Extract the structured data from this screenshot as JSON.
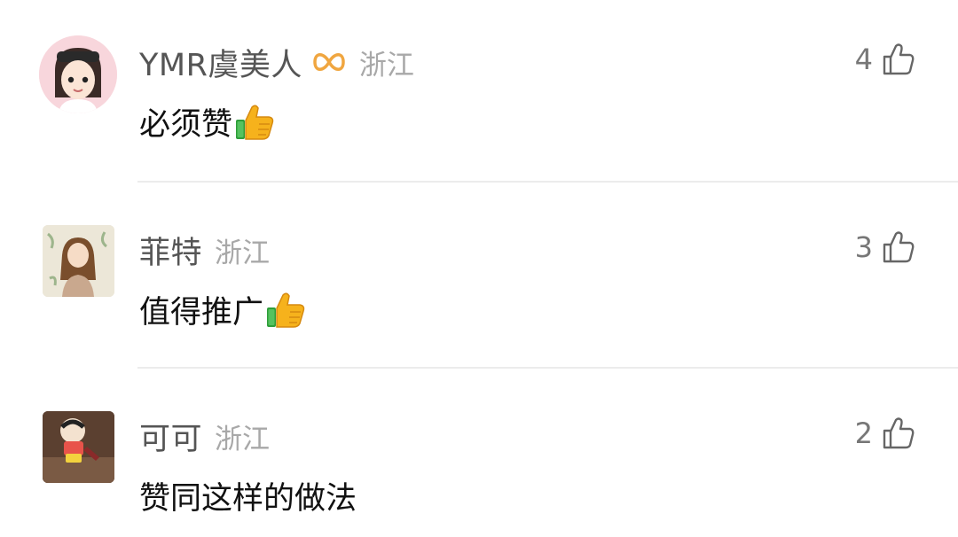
{
  "comments": [
    {
      "username": "YMR虞美人",
      "location": "浙江",
      "text": "必须赞",
      "likes": "4",
      "has_vip_badge": true,
      "has_thumb_emoji": true
    },
    {
      "username": "菲特",
      "location": "浙江",
      "text": "值得推广",
      "likes": "3",
      "has_vip_badge": false,
      "has_thumb_emoji": true
    },
    {
      "username": "可可",
      "location": "浙江",
      "text": "赞同这样的做法",
      "likes": "2",
      "has_vip_badge": false,
      "has_thumb_emoji": false
    }
  ],
  "colors": {
    "username": "#555555",
    "location": "#a8a8a8",
    "text": "#111111",
    "vip_badge": "#f0a640",
    "divider": "#ececec"
  },
  "icons": {
    "like": "thumbs-up-outline-icon",
    "vip": "vip-infinity-icon",
    "emoji": "thumbs-up-emoji-icon"
  }
}
